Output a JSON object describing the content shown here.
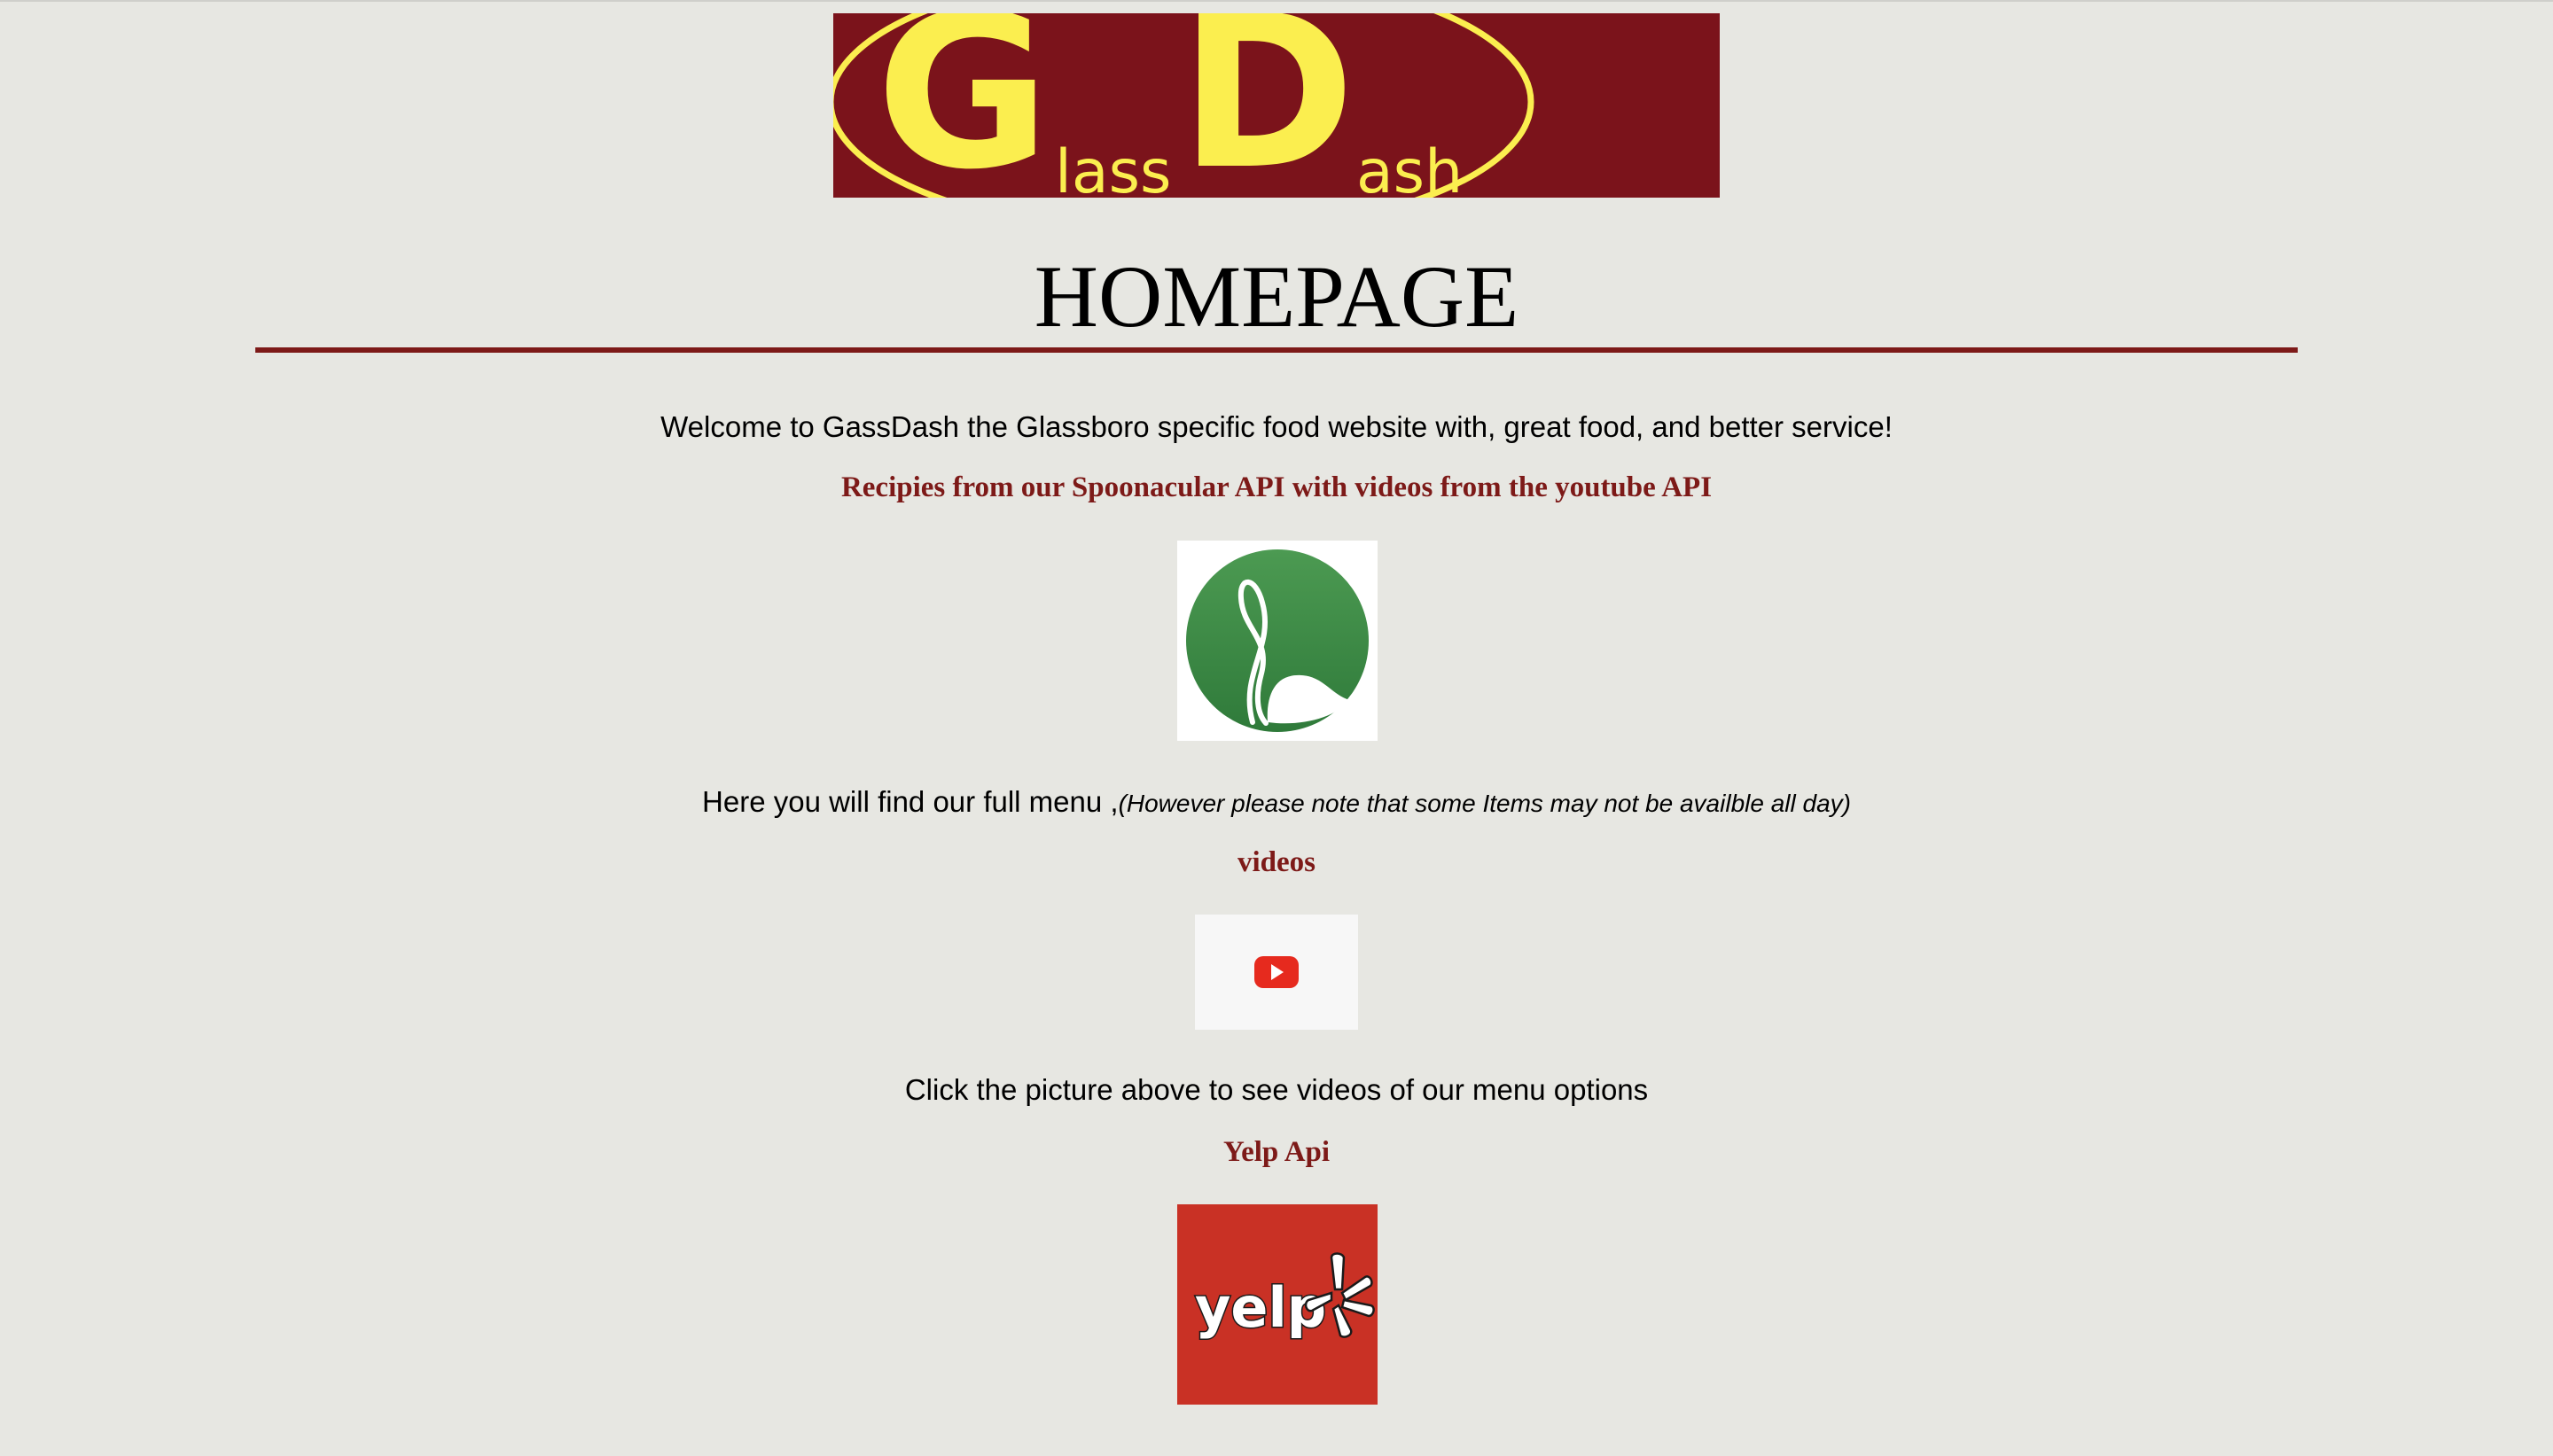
{
  "logo": {
    "big_g": "G",
    "small_g": "lass",
    "big_d": "D",
    "small_d": "ash",
    "bg_color": "#7b131b",
    "fg_color": "#fbee4f"
  },
  "heading": {
    "title": "HOMEPAGE"
  },
  "intro": {
    "welcome": "Welcome to GassDash the Glassboro specific food website with, great food, and better service!"
  },
  "spoonacular": {
    "subheading": "Recipies from our Spoonacular API with videos from the youtube API",
    "icon": "spoonacular-logo"
  },
  "menu": {
    "text": "Here you will find our full menu ,",
    "note": "(However please note that some Items may not be availble all day)"
  },
  "videos": {
    "subheading": "videos",
    "icon": "youtube-play-icon",
    "caption": "Click the picture above to see videos of our menu options"
  },
  "yelp": {
    "subheading": "Yelp Api",
    "logo_text": "yelp",
    "icon": "yelp-logo",
    "brand_color": "#c93125"
  },
  "colors": {
    "accent": "#7d1a18",
    "background": "#e7e7e2"
  }
}
